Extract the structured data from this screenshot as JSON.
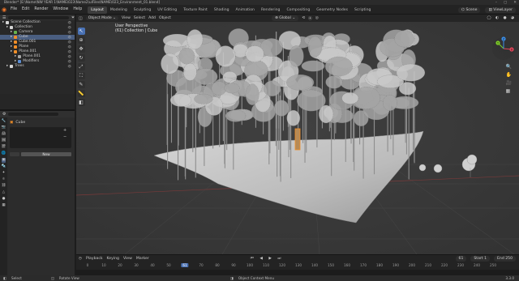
{
  "titlebar": {
    "title": "Blender* [E:\\Name\\NW YEAR 1\\NAME\\023\\Name2\\ulFiles\\NAME\\023_Environment_01.blend]",
    "controls": [
      "–",
      "▢",
      "✕"
    ]
  },
  "menubar": {
    "menus": [
      "File",
      "Edit",
      "Render",
      "Window",
      "Help"
    ],
    "workspaces": [
      "Layout",
      "Modeling",
      "Sculpting",
      "UV Editing",
      "Texture Paint",
      "Shading",
      "Animation",
      "Rendering",
      "Compositing",
      "Geometry Nodes",
      "Scripting"
    ],
    "active_workspace": "Layout",
    "scene_label": "Scene",
    "view_layer_label": "ViewLayer"
  },
  "outliner": {
    "header": "Scene Collection",
    "items": [
      {
        "label": "Scene Collection",
        "indent": 0,
        "color": "#d6d6d6"
      },
      {
        "label": "Collection",
        "indent": 1,
        "color": "#d6d6d6"
      },
      {
        "label": "Camera",
        "indent": 2,
        "color": "#68b24f"
      },
      {
        "label": "Cube",
        "indent": 2,
        "color": "#f08e28",
        "selected": true
      },
      {
        "label": "Cube.001",
        "indent": 2,
        "color": "#f08e28"
      },
      {
        "label": "Plane",
        "indent": 2,
        "color": "#f08e28"
      },
      {
        "label": "Plane.001",
        "indent": 2,
        "color": "#f08e28"
      },
      {
        "label": "Plane.001",
        "indent": 3,
        "color": "#a6a6a6"
      },
      {
        "label": "Modifiers",
        "indent": 3,
        "color": "#5d8fd5"
      },
      {
        "label": "Trees",
        "indent": 1,
        "color": "#d6d6d6"
      }
    ]
  },
  "properties": {
    "object_name": "Cube",
    "button_label": "New",
    "tabs": [
      "tool",
      "render",
      "output",
      "view",
      "scene",
      "world",
      "object",
      "modifiers",
      "particles",
      "physics",
      "constraints",
      "data",
      "material",
      "texture"
    ]
  },
  "viewport": {
    "mode": "Object Mode",
    "menus": [
      "View",
      "Select",
      "Add",
      "Object"
    ],
    "transform_orientation": "Global",
    "info_line1": "User Perspective",
    "info_line2": "(61) Collection | Cube",
    "gizmo_axes": [
      "X",
      "Y",
      "Z"
    ]
  },
  "timeline": {
    "menus": [
      "Playback",
      "Keying",
      "View",
      "Marker"
    ],
    "current_frame": "61",
    "start_label": "Start",
    "start_value": "1",
    "end_label": "End",
    "end_value": "250",
    "ticks": [
      "0",
      "10",
      "20",
      "30",
      "40",
      "50",
      "61",
      "70",
      "80",
      "90",
      "100",
      "110",
      "120",
      "130",
      "140",
      "150",
      "160",
      "170",
      "180",
      "190",
      "200",
      "210",
      "220",
      "230",
      "240",
      "250"
    ]
  },
  "statusbar": {
    "left": "Select",
    "middle_left": "Rotate View",
    "middle": "Object Context Menu",
    "version": "3.3.0"
  },
  "colors": {
    "accent": "#4a72b5",
    "selection": "#f08e28",
    "active_frame": "#4a72b5"
  }
}
